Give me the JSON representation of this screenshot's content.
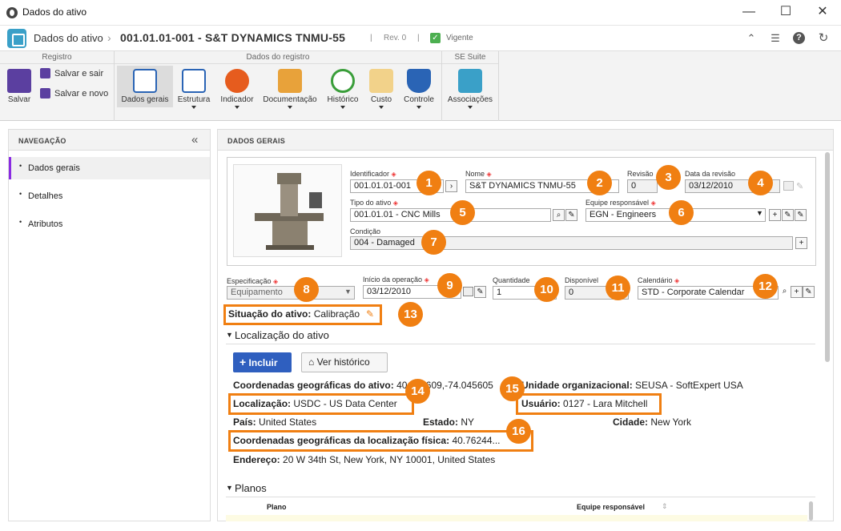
{
  "window": {
    "title": "Dados do ativo",
    "minimize": "—",
    "maximize": "☐",
    "close": "✕"
  },
  "header": {
    "module": "Dados do ativo",
    "separator": "›",
    "document": "001.01.01-001 - S&T DYNAMICS TNMU-55",
    "pipe": "|",
    "revision": "Rev. 0",
    "status": "Vigente",
    "icons": [
      "collapse-up-icon",
      "list-icon",
      "help-icon",
      "refresh-icon"
    ]
  },
  "ribbon": {
    "groups": [
      "Registro",
      "Dados do registro",
      "SE Suite"
    ],
    "save": "Salvar",
    "save_exit": "Salvar e sair",
    "save_new": "Salvar e novo",
    "buttons": [
      "Dados gerais",
      "Estrutura",
      "Indicador",
      "Documentação",
      "Histórico",
      "Custo",
      "Controle",
      "Associações"
    ]
  },
  "nav": {
    "title": "NAVEGAÇÃO",
    "collapse": "«",
    "items": [
      "Dados gerais",
      "Detalhes",
      "Atributos"
    ]
  },
  "main": {
    "title": "DADOS GERAIS",
    "identificador_label": "Identificador",
    "identificador": "001.01.01-001",
    "nome_label": "Nome",
    "nome": "S&T DYNAMICS TNMU-55",
    "revisao_label": "Revisão",
    "revisao": "0",
    "data_revisao_label": "Data da revisão",
    "data_revisao": "03/12/2010",
    "tipo_label": "Tipo do ativo",
    "tipo": "001.01.01 - CNC Mills",
    "equipe_label": "Equipe responsável",
    "equipe": "EGN - Engineers",
    "condicao_label": "Condição",
    "condicao": "004 - Damaged",
    "especificacao_label": "Especificação",
    "especificacao": "Equipamento",
    "inicio_label": "Início da operação",
    "inicio": "03/12/2010",
    "quantidade_label": "Quantidade",
    "quantidade": "1",
    "disponivel_label": "Disponível",
    "disponivel": "0",
    "calendario_label": "Calendário",
    "calendario": "STD - Corporate Calendar",
    "situacao_label": "Situação do ativo:",
    "situacao": "Calibração",
    "localizacao_section": "Localização do ativo",
    "incluir": "Incluir",
    "ver_historico": "Ver histórico",
    "coord_label": "Coordenadas geográficas do ativo:",
    "coord": "40.762609,-74.045605",
    "unidade_label": "Unidade organizacional:",
    "unidade": "SEUSA - SoftExpert USA",
    "localizacao_label": "Localização:",
    "localizacao": "USDC - US Data Center",
    "usuario_label": "Usuário:",
    "usuario": "0127 - Lara Mitchell",
    "pais_label": "País:",
    "pais": "United States",
    "estado_label": "Estado:",
    "estado": "NY",
    "cidade_label": "Cidade:",
    "cidade": "New York",
    "coord_fisica_label": "Coordenadas geográficas da localização física:",
    "coord_fisica": "40.76244...",
    "endereco_label": "Endereço:",
    "endereco": "20 W 34th St, New York, NY 10001, United States",
    "planos_section": "Planos",
    "col_plano": "Plano",
    "col_equipe": "Equipe responsável"
  },
  "badges": [
    "1",
    "2",
    "3",
    "4",
    "5",
    "6",
    "7",
    "8",
    "9",
    "10",
    "11",
    "12",
    "13",
    "14",
    "15",
    "16"
  ],
  "colors": {
    "accent_orange": "#f07f12",
    "nav_active": "#8a2be2",
    "primary_button": "#2f5fbf",
    "status_green": "#4caf50"
  }
}
